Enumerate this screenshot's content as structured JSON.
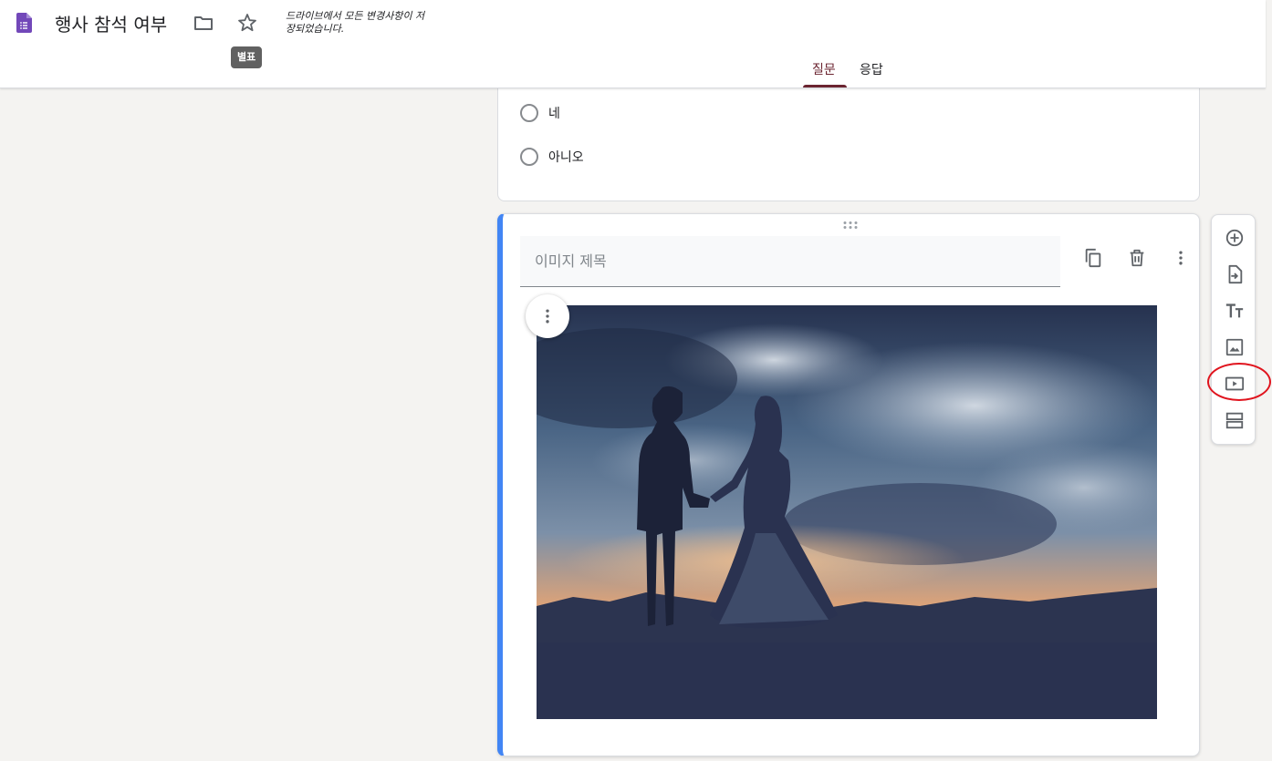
{
  "header": {
    "doc_title": "행사 참석 여부",
    "save_status": "드라이브에서 모든 변경사항이 저장되었습니다.",
    "tooltip": "별표",
    "tabs": [
      {
        "label": "질문",
        "active": true
      },
      {
        "label": "응답",
        "active": false
      }
    ],
    "icons": [
      "forms-logo-icon",
      "folder-icon",
      "star-icon"
    ]
  },
  "question_options": [
    {
      "label": "네"
    },
    {
      "label": "아니오"
    }
  ],
  "image_item": {
    "title_placeholder": "이미지 제목",
    "title_value": "",
    "tools": [
      "duplicate-icon",
      "delete-icon",
      "more-vert-icon"
    ],
    "image_description_icon": "couple-silhouette-sunset-image"
  },
  "side_toolbar": {
    "buttons": [
      {
        "name": "add-question",
        "icon": "add-circle-icon"
      },
      {
        "name": "import-questions",
        "icon": "import-icon"
      },
      {
        "name": "add-title",
        "icon": "title-tt-icon"
      },
      {
        "name": "add-image",
        "icon": "image-icon"
      },
      {
        "name": "add-video",
        "icon": "video-icon",
        "highlighted": true
      },
      {
        "name": "add-section",
        "icon": "section-icon"
      }
    ]
  },
  "colors": {
    "accent": "#6b2430",
    "focus_bar": "#4285f4",
    "highlight": "#e0141e",
    "background": "#f4f3f1"
  }
}
